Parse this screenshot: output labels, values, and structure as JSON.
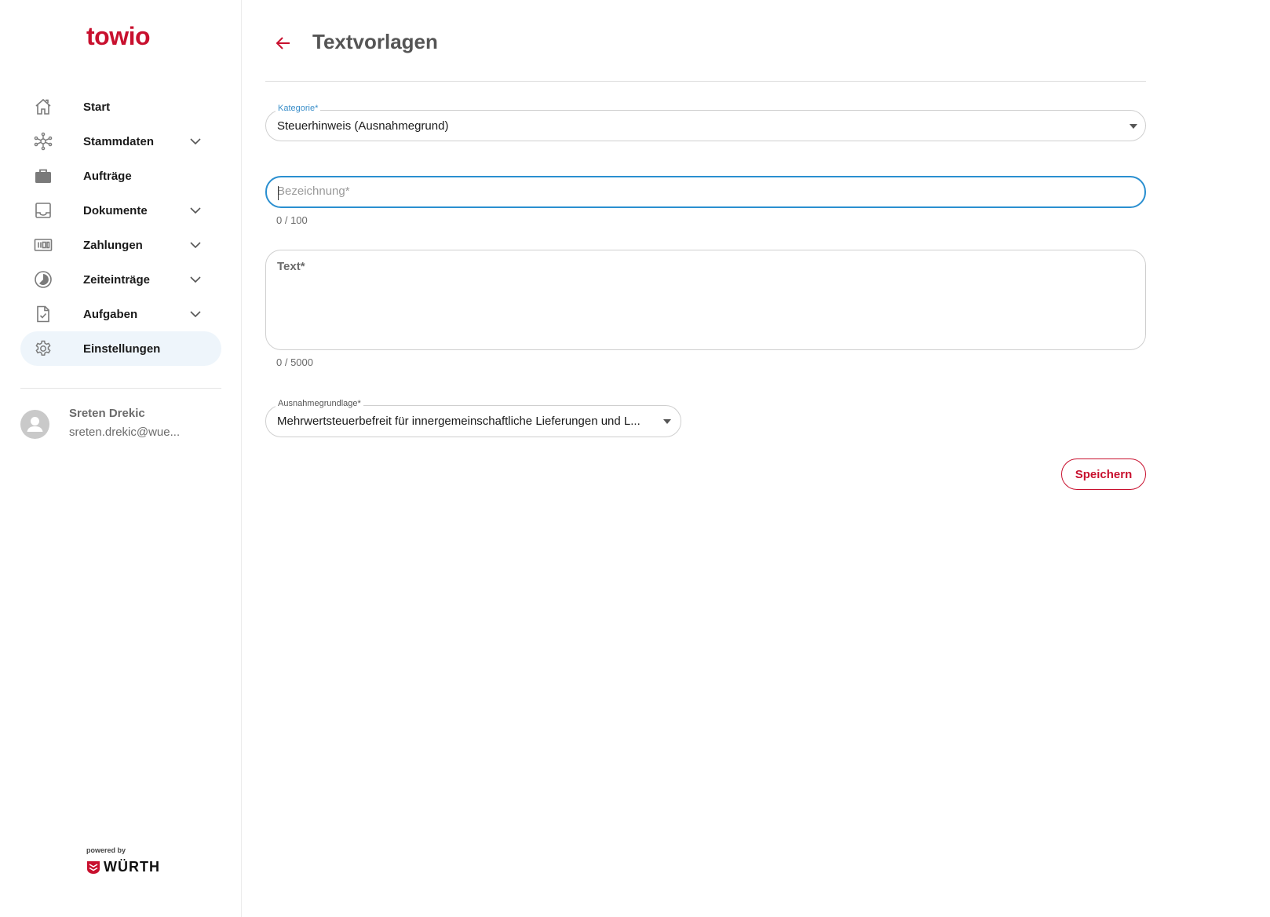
{
  "brand": {
    "logo_text": "towio",
    "powered_by": "powered by",
    "partner": "WÜRTH",
    "accent_color": "#c8102e",
    "focus_color": "#2a8fd0"
  },
  "sidebar": {
    "items": [
      {
        "label": "Start",
        "icon": "home-icon",
        "has_children": false,
        "active": false
      },
      {
        "label": "Stammdaten",
        "icon": "network-icon",
        "has_children": true,
        "active": false
      },
      {
        "label": "Aufträge",
        "icon": "briefcase-icon",
        "has_children": false,
        "active": false
      },
      {
        "label": "Dokumente",
        "icon": "inbox-icon",
        "has_children": true,
        "active": false
      },
      {
        "label": "Zahlungen",
        "icon": "barcode-icon",
        "has_children": true,
        "active": false
      },
      {
        "label": "Zeiteinträge",
        "icon": "clock-icon",
        "has_children": true,
        "active": false
      },
      {
        "label": "Aufgaben",
        "icon": "task-document-icon",
        "has_children": true,
        "active": false
      },
      {
        "label": "Einstellungen",
        "icon": "gear-icon",
        "has_children": false,
        "active": true
      }
    ],
    "user": {
      "name": "Sreten Drekic",
      "email": "sreten.drekic@wue..."
    }
  },
  "header": {
    "title": "Textvorlagen"
  },
  "form": {
    "kategorie": {
      "label": "Kategorie*",
      "value": "Steuerhinweis (Ausnahmegrund)"
    },
    "bezeichnung": {
      "placeholder": "Bezeichnung*",
      "value": "",
      "counter": "0 / 100"
    },
    "text": {
      "label": "Text*",
      "value": "",
      "counter": "0 / 5000"
    },
    "ausnahmegrundlage": {
      "label": "Ausnahmegrundlage*",
      "value": "Mehrwertsteuerbefreit für innergemeinschaftliche Lieferungen und L..."
    },
    "save_label": "Speichern"
  }
}
